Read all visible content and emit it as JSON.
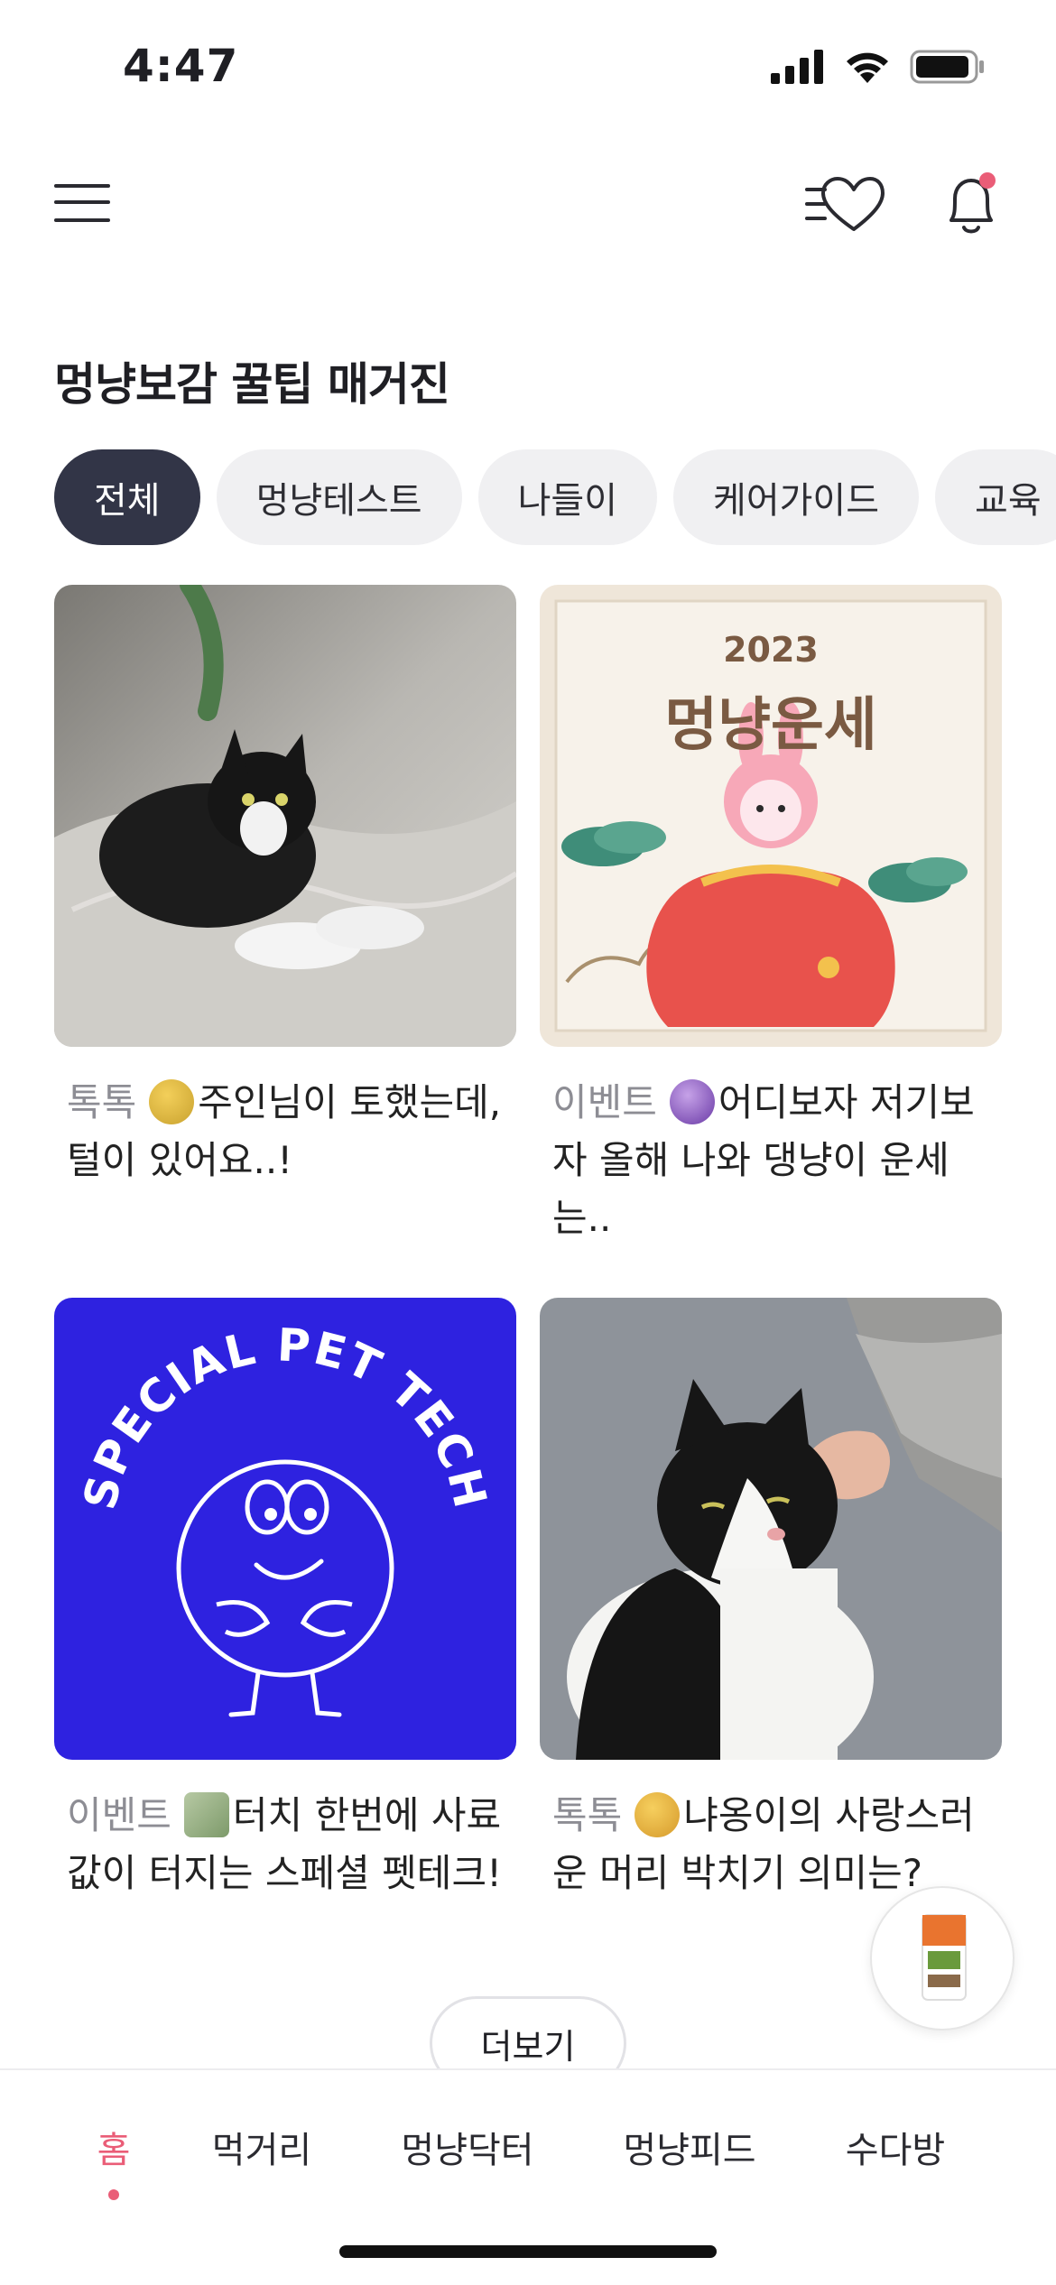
{
  "status_bar": {
    "time": "4:47"
  },
  "header": {
    "menu_icon": "hamburger-menu-icon",
    "wishlist_icon": "heart-list-icon",
    "notification_icon": "bell-icon",
    "notification_badge_color": "#ea5d77"
  },
  "page_title": "멍냥보감 꿀팁 매거진",
  "tabs": [
    {
      "label": "전체",
      "active": true
    },
    {
      "label": "멍냥테스트"
    },
    {
      "label": "나들이"
    },
    {
      "label": "케어가이드"
    },
    {
      "label": "교육"
    }
  ],
  "cards": [
    {
      "tag": "톡톡",
      "text": "주인님이 토했는데, 털이 있어요..!",
      "emoji_icon": "nauseated-face-icon"
    },
    {
      "tag": "이벤트",
      "text": "어디보자 저기보자 올해 나와 댕냥이 운세는..",
      "emoji_icon": "crystal-ball-icon",
      "image_title": "2023",
      "image_subtitle": "멍냥운세"
    },
    {
      "tag": "이벤트",
      "text": "터치 한번에 사료값이 터지는 스페셜 펫테크!",
      "emoji_icon": "money-wings-icon",
      "image_text": "SPECIAL PET TECH"
    },
    {
      "tag": "톡톡",
      "text": "냐옹이의 사랑스러운 머리 박치기 의미는?",
      "emoji_icon": "kissing-cat-icon"
    }
  ],
  "more_button": "더보기",
  "bottom_nav": [
    {
      "label": "홈",
      "active": true
    },
    {
      "label": "먹거리"
    },
    {
      "label": "멍냥닥터"
    },
    {
      "label": "멍냥피드"
    },
    {
      "label": "수다방"
    }
  ],
  "colors": {
    "accent": "#ea5d77",
    "active_tab": "#323547",
    "tech_blue": "#2e22e0"
  }
}
